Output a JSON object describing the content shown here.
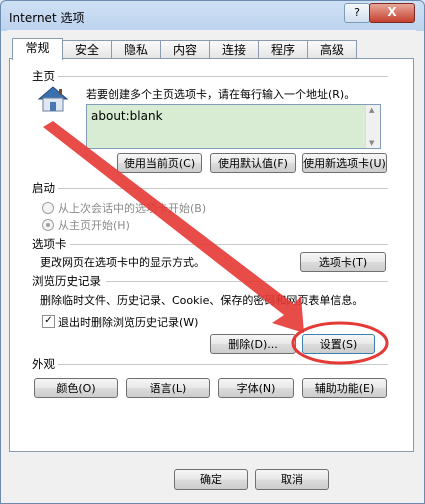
{
  "window": {
    "title": "Internet 选项",
    "help_label": "?",
    "close_label": "X"
  },
  "tabs": [
    "常规",
    "安全",
    "隐私",
    "内容",
    "连接",
    "程序",
    "高级"
  ],
  "homepage": {
    "section": "主页",
    "description": "若要创建多个主页选项卡，请在每行输入一个地址(R)。",
    "value": "about:blank",
    "buttons": [
      "使用当前页(C)",
      "使用默认值(F)",
      "使用新选项卡(U)"
    ]
  },
  "startup": {
    "section": "启动",
    "options": [
      "从上次会话中的选项卡开始(B)",
      "从主页开始(H)"
    ]
  },
  "tabs_section": {
    "section": "选项卡",
    "description": "更改网页在选项卡中的显示方式。",
    "button": "选项卡(T)"
  },
  "history": {
    "section": "浏览历史记录",
    "description": "删除临时文件、历史记录、Cookie、保存的密码和网页表单信息。",
    "checkbox": "退出时删除浏览历史记录(W)",
    "check_mark": "✓",
    "delete_button": "删除(D)...",
    "settings_button": "设置(S)"
  },
  "appearance": {
    "section": "外观",
    "buttons": [
      "颜色(O)",
      "语言(L)",
      "字体(N)",
      "辅助功能(E)"
    ]
  },
  "footer": {
    "ok": "确定",
    "cancel": "取消"
  },
  "annotation_color": "#e53935"
}
